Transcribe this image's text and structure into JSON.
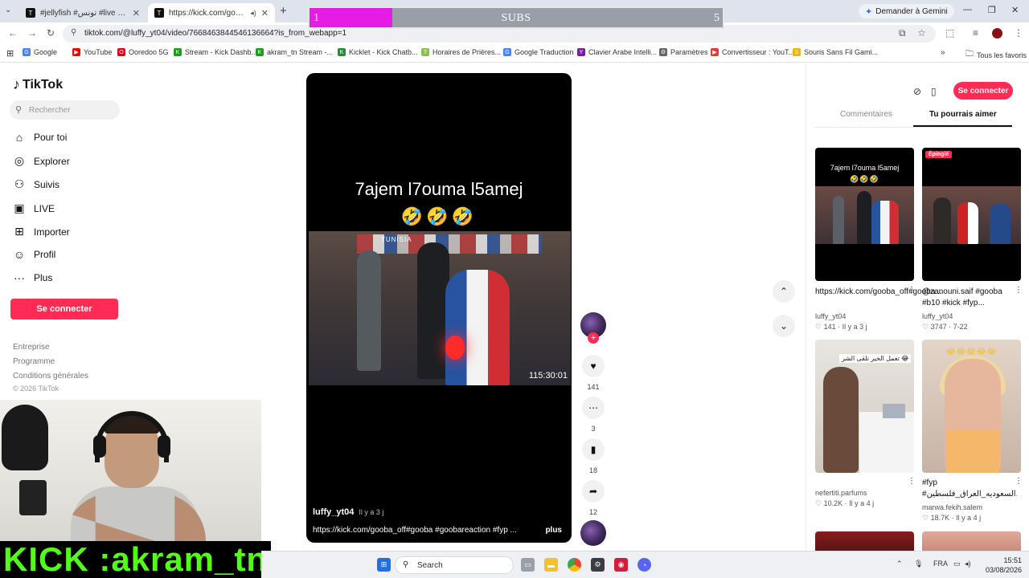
{
  "browser": {
    "tabs": [
      {
        "title": "#jellyfish #تونس #live #foryou",
        "active": false,
        "favicon": "T"
      },
      {
        "title": "https://kick.com/gooba_off",
        "active": true,
        "favicon": "T"
      }
    ],
    "new_tab_glyph": "+",
    "gemini_label": "Demander à Gemini",
    "url": "tiktok.com/@luffy_yt04/video/7668463844546136664?is_from_webapp=1",
    "bookmarks": [
      {
        "label": "Google",
        "color": "#4285f4",
        "glyph": "G"
      },
      {
        "label": "YouTube",
        "color": "#ff0000",
        "glyph": "▶"
      },
      {
        "label": "Ooredoo 5G",
        "color": "#e2001a",
        "glyph": "O"
      },
      {
        "label": "Stream - Kick Dashb...",
        "color": "#1a9f1a",
        "glyph": "K"
      },
      {
        "label": "akram_tn Stream -...",
        "color": "#1a9f1a",
        "glyph": "K"
      },
      {
        "label": "Kicklet - Kick Chatb...",
        "color": "#2b8a3e",
        "glyph": "K"
      },
      {
        "label": "Horaires de Prières...",
        "color": "#8bc34a",
        "glyph": "T"
      },
      {
        "label": "Google Traduction",
        "color": "#4285f4",
        "glyph": "G"
      },
      {
        "label": "Clavier Arabe Intelli...",
        "color": "#7b1fa2",
        "glyph": "Y"
      },
      {
        "label": "Paramètres",
        "color": "#666666",
        "glyph": "⚙"
      },
      {
        "label": "Convertisseur : YouT...",
        "color": "#e53935",
        "glyph": "▶"
      },
      {
        "label": "Souris Sans Fil Gami...",
        "color": "#f2b600",
        "glyph": "S"
      }
    ],
    "all_bookmarks_label": "Tous les favoris"
  },
  "subs_overlay": {
    "current": "1",
    "label": "SUBS",
    "goal": "5",
    "progress": 0.2,
    "fill_color": "#e61ce6"
  },
  "sidebar": {
    "logo": "TikTok",
    "search_placeholder": "Rechercher",
    "nav": [
      {
        "label": "Pour toi",
        "icon": "home-icon",
        "glyph": "⌂"
      },
      {
        "label": "Explorer",
        "icon": "compass-icon",
        "glyph": "◎"
      },
      {
        "label": "Suivis",
        "icon": "following-icon",
        "glyph": "⚇"
      },
      {
        "label": "LIVE",
        "icon": "live-icon",
        "glyph": "▣"
      },
      {
        "label": "Importer",
        "icon": "upload-icon",
        "glyph": "⊞"
      },
      {
        "label": "Profil",
        "icon": "profile-icon",
        "glyph": "☺"
      },
      {
        "label": "Plus",
        "icon": "more-icon",
        "glyph": "···"
      }
    ],
    "login_label": "Se connecter",
    "footer_links": [
      "Entreprise",
      "Programme",
      "Conditions générales"
    ],
    "copyright": "© 2026 TikTok"
  },
  "stream_overlay": {
    "channel_label": "KICK :akram_tn",
    "channel_color": "#53fc18"
  },
  "video": {
    "title": "7ajem l7ouma l5amej",
    "emoji": "🤣🤣🤣",
    "banner_text": "TUNISIA",
    "timestamp": "115:30:01",
    "author": "luffy_yt04",
    "posted": "Il y a 3 j",
    "caption": "https://kick.com/gooba_off#gooba #goobareaction #fyp ...",
    "more_label": "plus"
  },
  "actions": {
    "likes": "141",
    "comments": "3",
    "saves": "18",
    "shares": "12"
  },
  "right_panel": {
    "login_label": "Se connecter",
    "tabs": [
      "Commentaires",
      "Tu pourrais aimer"
    ],
    "active_tab": 1,
    "cards": [
      {
        "title": "https://kick.com/gooba_off#gooba...",
        "author": "luffy_yt04",
        "likes": "141",
        "age": "Il y a 3 j",
        "thumb_caption": "7ajem l7ouma l5amej",
        "thumb_emoji": "🤣🤣🤣"
      },
      {
        "title": "@zanouni.saif #gooba #b10 #kick #fyp...",
        "author": "luffy_yt04",
        "likes": "3747",
        "age": "7-22",
        "pinned_label": "Épinglé"
      },
      {
        "title": "",
        "author": "nefertiti.parfums",
        "likes": "10.2K",
        "age": "Il y a 4 j",
        "thumb_caption": "تعمل الخير تلقى الشر 😂"
      },
      {
        "title": "#fyp #السعوديه_العراق_فلسطين...",
        "author": "marwa.fekih.salem",
        "likes": "18.7K",
        "age": "Il y a 4 j",
        "thumb_emoji": "😂😂😂😂😂"
      }
    ]
  },
  "taskbar": {
    "search_label": "Search",
    "language": "FRA",
    "time": "15:51",
    "date": "03/08/2026"
  }
}
